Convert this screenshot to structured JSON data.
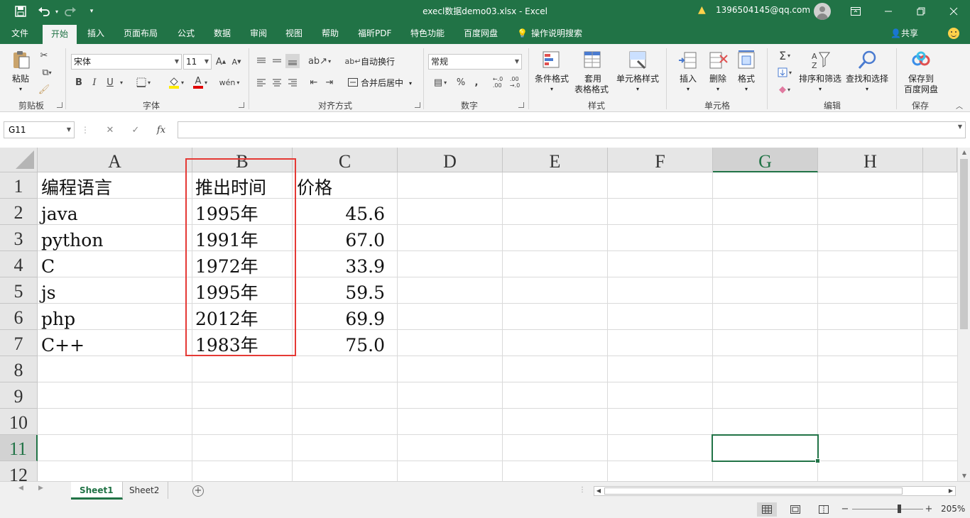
{
  "titlebar": {
    "title": "execl数据demo03.xlsx  -  Excel",
    "user": "1396504145@qq.com",
    "icons": {
      "save": "save-icon",
      "undo": "undo-icon",
      "redo": "redo-icon",
      "customize": "customize-quick-access-icon"
    }
  },
  "tabs": [
    {
      "label": "文件"
    },
    {
      "label": "开始"
    },
    {
      "label": "插入"
    },
    {
      "label": "页面布局"
    },
    {
      "label": "公式"
    },
    {
      "label": "数据"
    },
    {
      "label": "审阅"
    },
    {
      "label": "视图"
    },
    {
      "label": "帮助"
    },
    {
      "label": "福昕PDF"
    },
    {
      "label": "特色功能"
    },
    {
      "label": "百度网盘"
    }
  ],
  "tell_me": "操作说明搜索",
  "share": "共享",
  "ribbon": {
    "clipboard": {
      "paste": "粘贴",
      "label": "剪贴板"
    },
    "font": {
      "name": "宋体",
      "size": "11",
      "label": "字体",
      "bold": "B",
      "italic": "I",
      "underline": "U"
    },
    "alignment": {
      "wrap": "自动换行",
      "merge": "合并后居中",
      "label": "对齐方式"
    },
    "number": {
      "format": "常规",
      "percent": "%",
      "comma": ",",
      "label": "数字"
    },
    "styles": {
      "conditional": "条件格式",
      "table_a": "套用",
      "table_b": "表格格式",
      "cell_styles": "单元格样式",
      "label": "样式"
    },
    "cells": {
      "insert": "插入",
      "delete": "删除",
      "format": "格式",
      "label": "单元格"
    },
    "editing": {
      "sort": "排序和筛选",
      "find": "查找和选择",
      "label": "编辑"
    },
    "save": {
      "line1": "保存到",
      "line2": "百度网盘",
      "label": "保存"
    }
  },
  "formula_bar": {
    "name_box": "G11",
    "fx": "fx",
    "value": ""
  },
  "columns": [
    "A",
    "B",
    "C",
    "D",
    "E",
    "F",
    "G",
    "H"
  ],
  "rows": [
    "1",
    "2",
    "3",
    "4",
    "5",
    "6",
    "7",
    "8",
    "9",
    "10",
    "11",
    "12"
  ],
  "cells": {
    "r1": {
      "a": "编程语言",
      "b": "推出时间",
      "c": "价格"
    },
    "r2": {
      "a": "java",
      "b": "1995年",
      "c": "45.6"
    },
    "r3": {
      "a": "python",
      "b": "1991年",
      "c": "67.0"
    },
    "r4": {
      "a": "C",
      "b": "1972年",
      "c": "33.9"
    },
    "r5": {
      "a": "js",
      "b": "1995年",
      "c": "59.5"
    },
    "r6": {
      "a": "php",
      "b": "2012年",
      "c": "69.9"
    },
    "r7": {
      "a": "C++",
      "b": "1983年",
      "c": "75.0"
    }
  },
  "sheets": [
    {
      "label": "Sheet1"
    },
    {
      "label": "Sheet2"
    }
  ],
  "status": {
    "zoom": "205%"
  },
  "colors": {
    "accent": "#217346",
    "highlight_box": "#e53935"
  }
}
